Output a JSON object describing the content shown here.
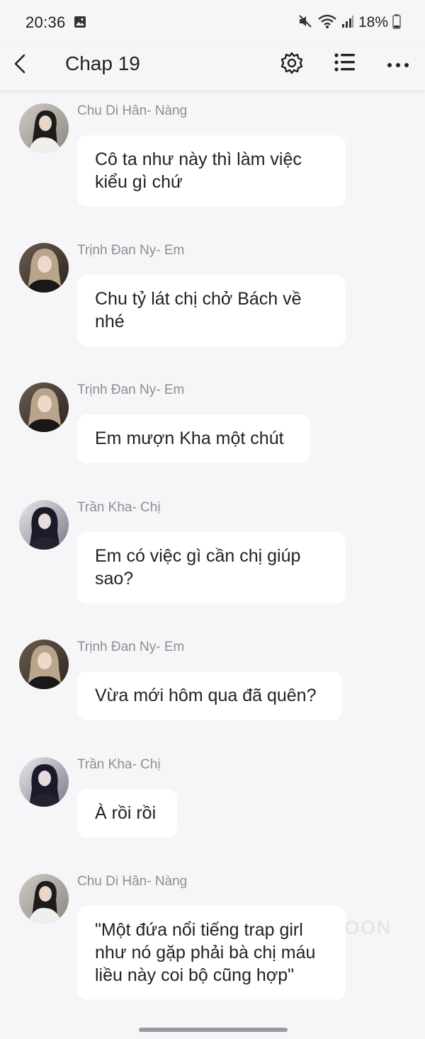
{
  "status_bar": {
    "time": "20:36",
    "battery": "18%",
    "icons": [
      "gallery-icon",
      "mute-icon",
      "wifi-icon",
      "signal-icon",
      "battery-icon"
    ]
  },
  "app_bar": {
    "title": "Chap 19",
    "icons": [
      "back-icon",
      "gear-icon",
      "list-icon",
      "more-icon"
    ]
  },
  "messages": [
    {
      "sender": "Chu Di Hân- Nàng",
      "text": "Cô ta như này thì làm việc\nkiểu gì chứ",
      "avatar": "chu"
    },
    {
      "sender": "Trịnh Đan Ny- Em",
      "text": "Chu tỷ lát chị chở Bách về\nnhé",
      "avatar": "trinh"
    },
    {
      "sender": "Trịnh Đan Ny- Em",
      "text": "Em mượn Kha một chút",
      "avatar": "trinh"
    },
    {
      "sender": "Trần Kha- Chị",
      "text": "Em có việc gì cần chị giúp\nsao?",
      "avatar": "tran"
    },
    {
      "sender": "Trịnh Đan Ny- Em",
      "text": "Vừa mới hôm qua đã quên?",
      "avatar": "trinh"
    },
    {
      "sender": "Trần Kha- Chị",
      "text": "À rồi rồi",
      "avatar": "tran"
    },
    {
      "sender": "Chu Di Hân- Nàng",
      "text": "\"Một đứa nổi tiếng trap girl\nnhư nó gặp phải bà chị máu\nliều này coi bộ cũng hợp\"",
      "avatar": "chu"
    }
  ],
  "watermark": "OON"
}
